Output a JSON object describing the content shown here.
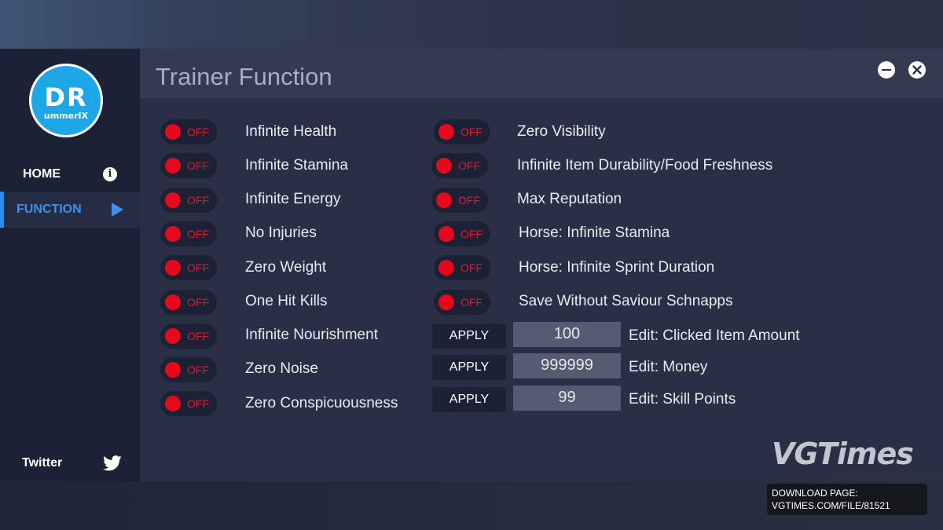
{
  "window": {
    "title": "Trainer Function"
  },
  "logo": {
    "main": "DR",
    "sub": "ummerIX"
  },
  "sidebar": {
    "items": [
      {
        "label": "HOME",
        "icon": "info-icon"
      },
      {
        "label": "FUNCTION",
        "icon": "play-icon",
        "active": true
      }
    ],
    "twitter_label": "Twitter"
  },
  "toggle_off_label": "OFF",
  "left_toggles": [
    "Infinite Health",
    "Infinite Stamina",
    "Infinite Energy",
    "No Injuries",
    "Zero Weight",
    "One Hit Kills",
    "Infinite Nourishment",
    "Zero Noise",
    "Zero Conspicuousness"
  ],
  "right_toggles": [
    "Zero Visibility",
    "Infinite Item Durability/Food Freshness",
    "Max Reputation",
    "Horse: Infinite Stamina",
    "Horse: Infinite Sprint Duration",
    "Save Without Saviour Schnapps"
  ],
  "edits": [
    {
      "button": "APPLY",
      "value": "100",
      "label": "Edit: Clicked Item Amount"
    },
    {
      "button": "APPLY",
      "value": "999999",
      "label": "Edit: Money"
    },
    {
      "button": "APPLY",
      "value": "99",
      "label": "Edit: Skill Points"
    }
  ],
  "watermark": {
    "brand": "VGTimes",
    "download_line1": "DOWNLOAD PAGE:",
    "download_line2": "VGTIMES.COM/FILE/81521"
  },
  "colors": {
    "accent": "#3d8fe8",
    "toggle_off": "#e6091d",
    "logo": "#1ea7e6",
    "panel": "#2a2f45",
    "sidebar": "#1c2136"
  }
}
